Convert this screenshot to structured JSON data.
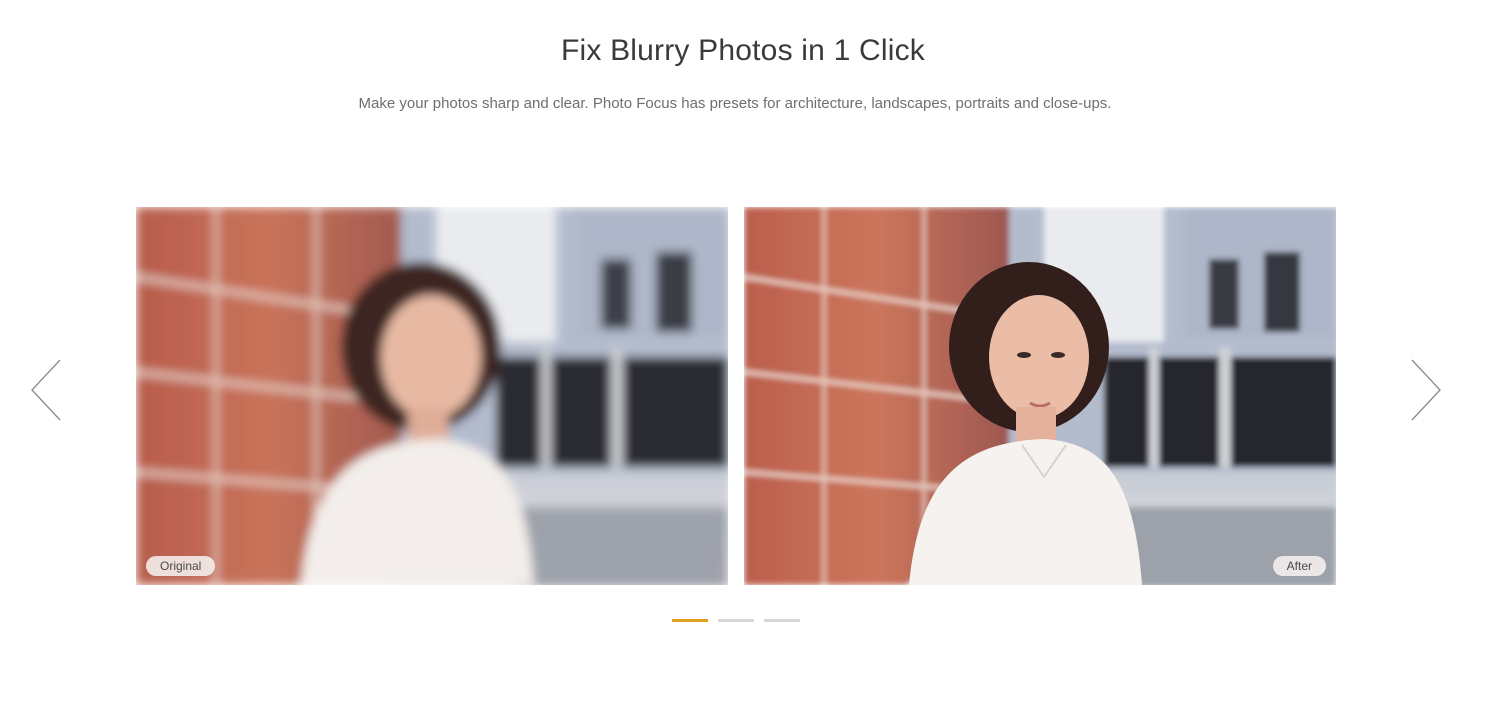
{
  "header": {
    "title": "Fix Blurry Photos in 1 Click",
    "subtitle": "Make your photos sharp and clear. Photo Focus has presets for architecture, landscapes, portraits and close-ups."
  },
  "carousel": {
    "prev_icon": "chevron-left-icon",
    "next_icon": "chevron-right-icon",
    "before_label": "Original",
    "after_label": "After",
    "slide_count": 3,
    "active_slide": 1
  },
  "colors": {
    "accent": "#e2a01e",
    "dot_inactive": "#d6d6d6",
    "brick": "#c46a52",
    "building": "#b9c1cf"
  }
}
